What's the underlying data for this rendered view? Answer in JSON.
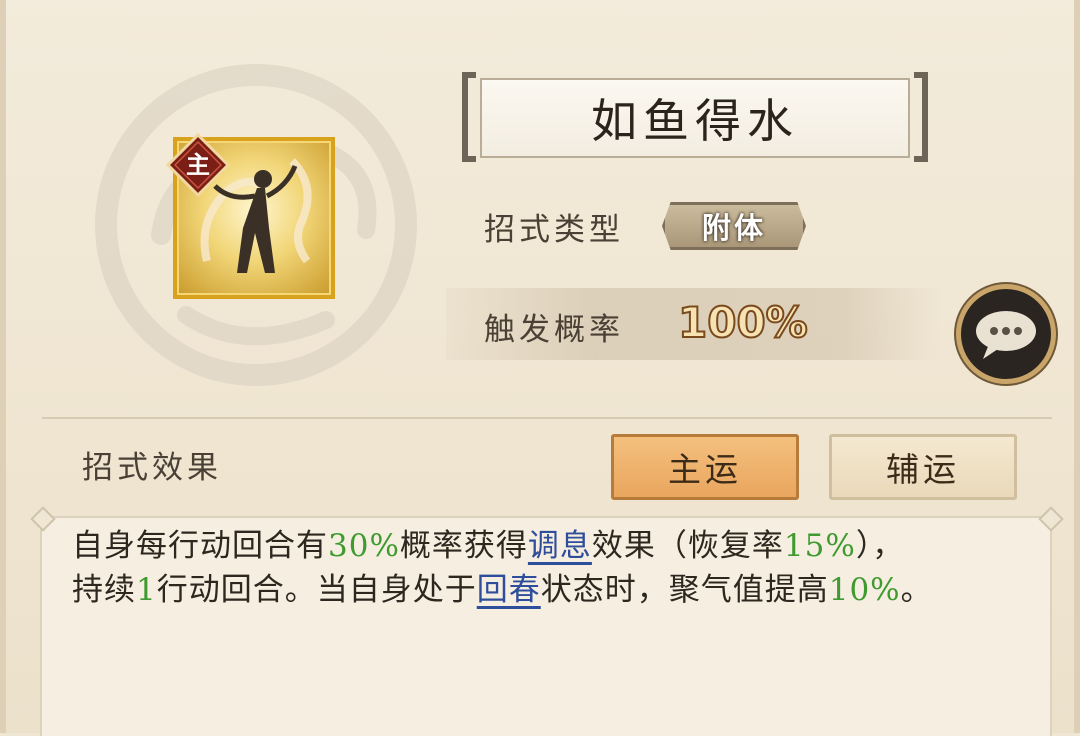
{
  "skill": {
    "name": "如鱼得水",
    "badge": "主",
    "icon": "dancer-figure-icon"
  },
  "info": {
    "type_label": "招式类型",
    "type_value": "附体",
    "prob_label": "触发概率",
    "prob_value": "100%"
  },
  "effect": {
    "label": "招式效果",
    "tabs": [
      {
        "label": "主运",
        "active": true
      },
      {
        "label": "辅运",
        "active": false
      }
    ],
    "desc": {
      "p1": "自身每行动回合有",
      "v1": "30%",
      "p2": "概率获得",
      "k1": "调息",
      "p3": "效果（恢复率",
      "v2": "15%",
      "p4": "），",
      "p5": "持续",
      "v3": "1",
      "p6": "行动回合。当自身处于",
      "k2": "回春",
      "p7": "状态时，聚气值提高",
      "v4": "10%",
      "p8": "。"
    }
  },
  "colors": {
    "highlight_green": "#3f9a30",
    "keyword_blue": "#2e4d9a",
    "active_tab": "#f0b56e",
    "icon_gold": "#d9a21c"
  }
}
